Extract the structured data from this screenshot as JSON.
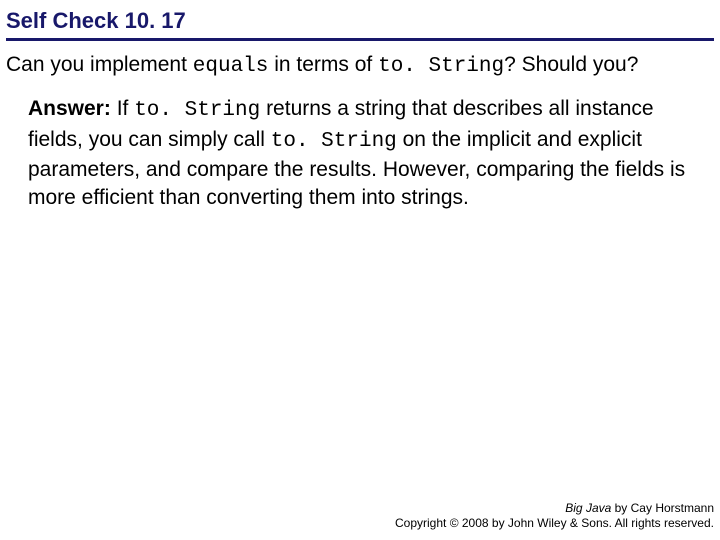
{
  "title": "Self Check 10. 17",
  "question": {
    "part1": "Can you implement ",
    "code1": "equals",
    "part2": " in terms of ",
    "code2": "to. String",
    "part3": "? Should you?"
  },
  "answer": {
    "label": "Answer:",
    "part1": " If ",
    "code1": "to. String",
    "part2": " returns a string that describes all instance fields, you can simply call ",
    "code2": "to. String",
    "part3": " on the implicit and explicit parameters, and compare the results. However, comparing the fields is more efficient than converting them into strings."
  },
  "footer": {
    "line1_italic": "Big Java",
    "line1_rest": " by Cay Horstmann",
    "line2": "Copyright © 2008 by John Wiley & Sons. All rights reserved."
  }
}
